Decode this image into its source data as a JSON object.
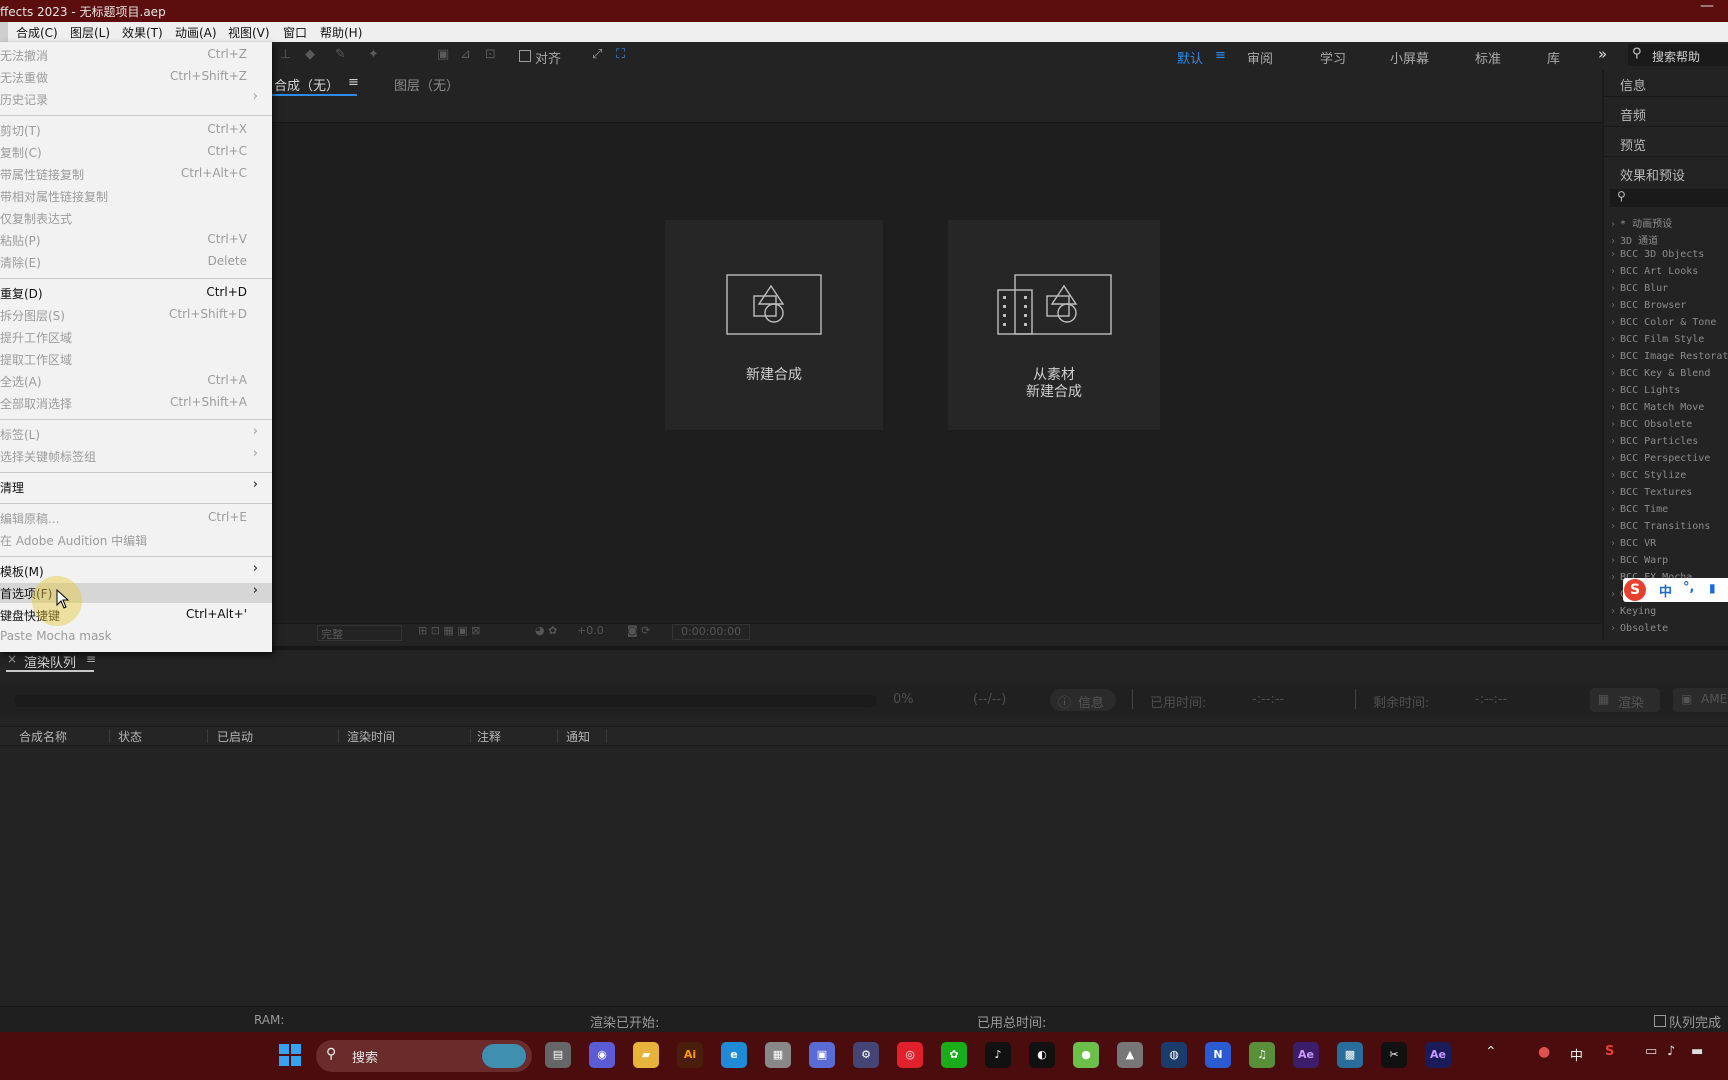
{
  "window": {
    "title": "ffects 2023 - 无标题项目.aep",
    "minimize": "—"
  },
  "menubar": [
    "合成(C)",
    "图层(L)",
    "效果(T)",
    "动画(A)",
    "视图(V)",
    "窗口",
    "帮助(H)"
  ],
  "toolbar": {
    "align_label": "对齐",
    "workspaces": [
      "默认",
      "审阅",
      "学习",
      "小屏幕",
      "标准",
      "库"
    ],
    "active_workspace_index": 0,
    "more": "»",
    "search_placeholder": "搜索帮助"
  },
  "comp_panel": {
    "tab_comp": "合成（无）",
    "tab_layer": "图层（无）",
    "menu_icon": "≡",
    "card_new_comp": "新建合成",
    "card_from_footage_1": "从素材",
    "card_from_footage_2": "新建合成",
    "footer_quality": "完整",
    "footer_exposure": "+0.0",
    "footer_timecode": "0:00:00:00"
  },
  "right_panel": {
    "headers": [
      "信息",
      "音频",
      "预览",
      "效果和预设"
    ],
    "effects": [
      "* 动画预设",
      "3D 通道",
      "BCC 3D Objects",
      "BCC Art Looks",
      "BCC Blur",
      "BCC Browser",
      "BCC Color & Tone",
      "BCC Film Style",
      "BCC Image Restorat",
      "BCC Key & Blend",
      "BCC Lights",
      "BCC Match Move",
      "BCC Obsolete",
      "BCC Particles",
      "BCC Perspective",
      "BCC Stylize",
      "BCC Textures",
      "BCC Time",
      "BCC Transitions",
      "BCC VR",
      "BCC Warp",
      "BCC FX Mocha",
      "C",
      "Keying",
      "Obsolete"
    ]
  },
  "ime": {
    "logo": "S",
    "lang": "中",
    "punct": "°,",
    "mic": "🎤"
  },
  "render_queue": {
    "close": "×",
    "tab": "渲染队列",
    "menu_icon": "≡",
    "progress_percent": "0%",
    "progress_value": 0,
    "count": "(--/--)",
    "info_btn": "信息",
    "elapsed_label": "已用时间:",
    "elapsed_value": "-:--:--",
    "remaining_label": "剩余时间:",
    "remaining_value": "-:--:--",
    "render_btn": "渲染",
    "ame_btn": "AME",
    "columns": [
      "合成名称",
      "状态",
      "已启动",
      "渲染时间",
      "注释",
      "通知"
    ]
  },
  "status_bar": {
    "ram": "RAM:",
    "render_started": "渲染已开始:",
    "total_time": "已用总时间:",
    "queue_done": "队列完成"
  },
  "edit_menu": [
    {
      "label": "无法撤消",
      "shortcut": "Ctrl+Z",
      "disabled": true
    },
    {
      "label": "无法重做",
      "shortcut": "Ctrl+Shift+Z",
      "disabled": true
    },
    {
      "label": "历史记录",
      "shortcut": "",
      "submenu": true,
      "disabled": true
    },
    {
      "separator": true
    },
    {
      "label": "剪切(T)",
      "shortcut": "Ctrl+X",
      "disabled": true
    },
    {
      "label": "复制(C)",
      "shortcut": "Ctrl+C",
      "disabled": true
    },
    {
      "label": "带属性链接复制",
      "shortcut": "Ctrl+Alt+C",
      "disabled": true
    },
    {
      "label": "带相对属性链接复制",
      "shortcut": "",
      "disabled": true
    },
    {
      "label": "仅复制表达式",
      "shortcut": "",
      "disabled": true
    },
    {
      "label": "粘贴(P)",
      "shortcut": "Ctrl+V",
      "disabled": true
    },
    {
      "label": "清除(E)",
      "shortcut": "Delete",
      "disabled": true
    },
    {
      "separator": true
    },
    {
      "label": "重复(D)",
      "shortcut": "Ctrl+D",
      "disabled": false
    },
    {
      "label": "拆分图层(S)",
      "shortcut": "Ctrl+Shift+D",
      "disabled": true
    },
    {
      "label": "提升工作区域",
      "shortcut": "",
      "disabled": true
    },
    {
      "label": "提取工作区域",
      "shortcut": "",
      "disabled": true
    },
    {
      "label": "全选(A)",
      "shortcut": "Ctrl+A",
      "disabled": true
    },
    {
      "label": "全部取消选择",
      "shortcut": "Ctrl+Shift+A",
      "disabled": true
    },
    {
      "separator": true
    },
    {
      "label": "标签(L)",
      "shortcut": "",
      "submenu": true,
      "disabled": true
    },
    {
      "label": "选择关键帧标签组",
      "shortcut": "",
      "submenu": true,
      "disabled": true
    },
    {
      "separator": true
    },
    {
      "label": "清理",
      "shortcut": "",
      "submenu": true,
      "disabled": false
    },
    {
      "separator": true
    },
    {
      "label": "编辑原稿...",
      "shortcut": "Ctrl+E",
      "disabled": true
    },
    {
      "label": "在 Adobe Audition 中编辑",
      "shortcut": "",
      "disabled": true
    },
    {
      "separator": true
    },
    {
      "label": "模板(M)",
      "shortcut": "",
      "submenu": true,
      "disabled": false
    },
    {
      "label": "首选项(F)",
      "shortcut": "",
      "submenu": true,
      "disabled": false,
      "highlight": true
    },
    {
      "label": "键盘快捷键",
      "shortcut": "Ctrl+Alt+'",
      "disabled": false
    },
    {
      "label": "Paste Mocha mask",
      "shortcut": "",
      "disabled": true
    }
  ],
  "taskbar": {
    "search_label": "搜索",
    "apps": [
      "explorer-app-icon",
      "teams-icon",
      "folder-icon",
      "illustrator-icon",
      "edge-icon",
      "store-icon",
      "box-icon",
      "settings-icon",
      "netease-music-icon",
      "wechat-icon",
      "tiktok-icon",
      "qq-icon",
      "app-green-icon",
      "app-gray-icon",
      "steam-icon",
      "nk-icon",
      "music-icon",
      "ae-icon",
      "remote-icon",
      "capcut-icon",
      "ae-active-icon"
    ],
    "tray_lang": "中"
  },
  "colors": {
    "accent": "#2d8ceb",
    "titlebar": "#5c0e0e",
    "taskbar": "#4a0c0c",
    "panel": "#232323"
  }
}
